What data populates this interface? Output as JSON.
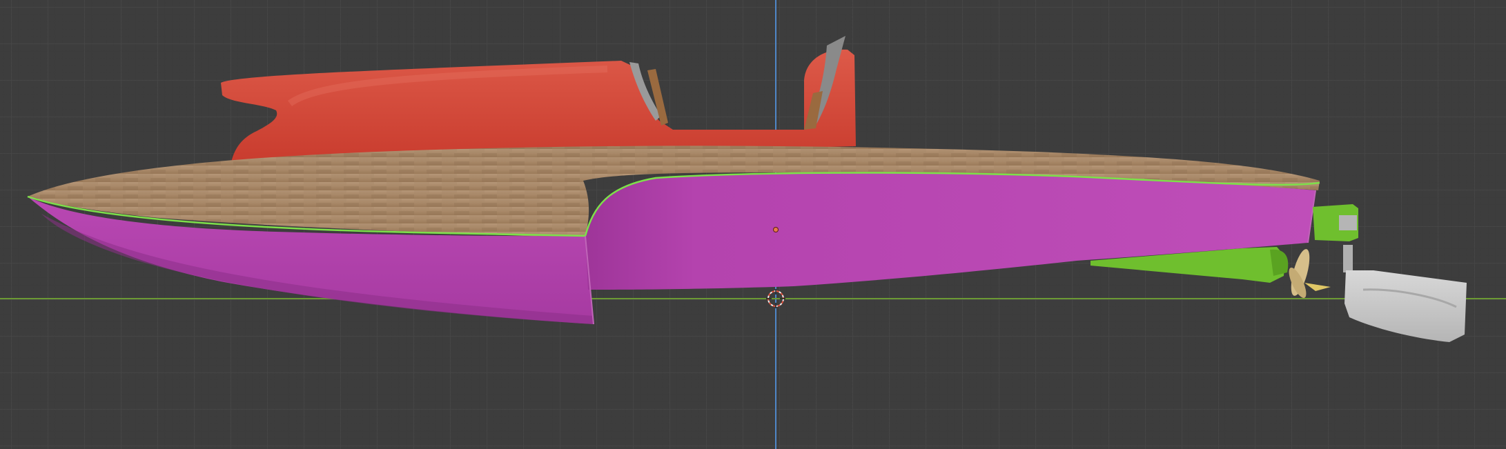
{
  "viewport": {
    "background": "#3d3d3d",
    "grid_color": "#474747"
  },
  "axes": {
    "y_axis_color": "#4f87c8",
    "x_axis_color": "#6c9a34"
  },
  "colors": {
    "hull": "#b643b0",
    "hull_dark": "#8c2f88",
    "deck": "#a68463",
    "deck_light": "#b89a78",
    "canopy": "#d14a3a",
    "canopy_light": "#e0604e",
    "selection_outline": "#7de04a",
    "strut": "#6fbf2e",
    "propeller": "#d6bf8a",
    "rudder": "#c9c9c9",
    "seat": "#9a6a3f",
    "windshield": "#8a8a8a",
    "origin_marker": "#e8794a",
    "cursor_red": "#e0523f",
    "cursor_white": "#f2f2f2"
  },
  "icons": {
    "cursor": "3d-cursor-icon",
    "origin": "object-origin-icon"
  }
}
